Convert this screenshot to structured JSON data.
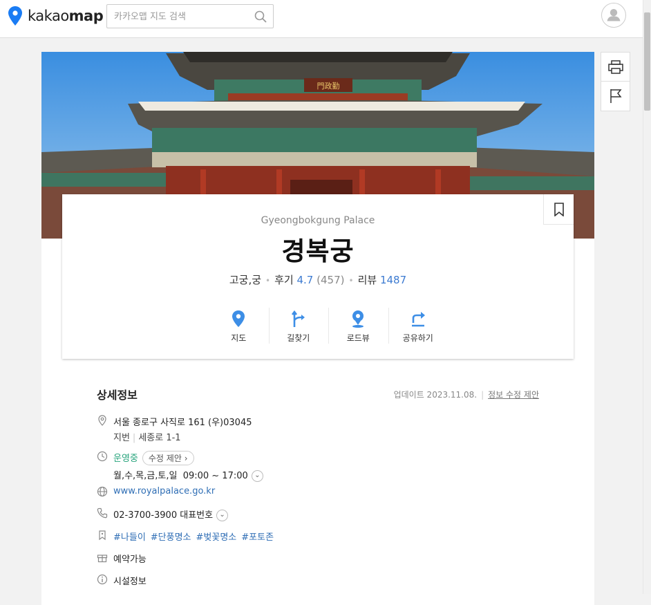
{
  "brand": {
    "name_light": "kakao",
    "name_bold": "map",
    "accent": "#1a7cf4"
  },
  "search": {
    "placeholder": "카카오맵 지도 검색",
    "icon": "search-icon"
  },
  "place": {
    "english_name": "Gyeongbokgung Palace",
    "korean_name": "경복궁",
    "category": "고궁,궁",
    "review_label": "후기",
    "rating": "4.7",
    "rating_count": "(457)",
    "blog_review_label": "리뷰",
    "blog_review_count": "1487"
  },
  "actions": [
    {
      "label": "지도",
      "icon": "map-pin-icon"
    },
    {
      "label": "길찾기",
      "icon": "directions-icon"
    },
    {
      "label": "로드뷰",
      "icon": "roadview-icon"
    },
    {
      "label": "공유하기",
      "icon": "share-icon"
    }
  ],
  "detail": {
    "title": "상세정보",
    "updated": "업데이트 2023.11.08.",
    "edit_link": "정보 수정 제안",
    "address": "서울 종로구 사직로 161 (우)03045",
    "jibun_label": "지번",
    "jibun": "세종로 1-1",
    "status": "운영중",
    "status_edit": "수정 제안",
    "hours_days": "월,수,목,금,토,일",
    "hours_time": "09:00 ~ 17:00",
    "website": "www.royalpalace.go.kr",
    "phone": "02-3700-3900",
    "phone_label": "대표번호",
    "tags": [
      "#나들이",
      "#단풍명소",
      "#벚꽃명소",
      "#포토존"
    ],
    "reservation": "예약가능",
    "facilities": "시설정보"
  },
  "colors": {
    "link": "#2f6eb5",
    "rating": "#3d7bd1",
    "open": "#26a37b",
    "action_icon": "#3d8ee6"
  }
}
